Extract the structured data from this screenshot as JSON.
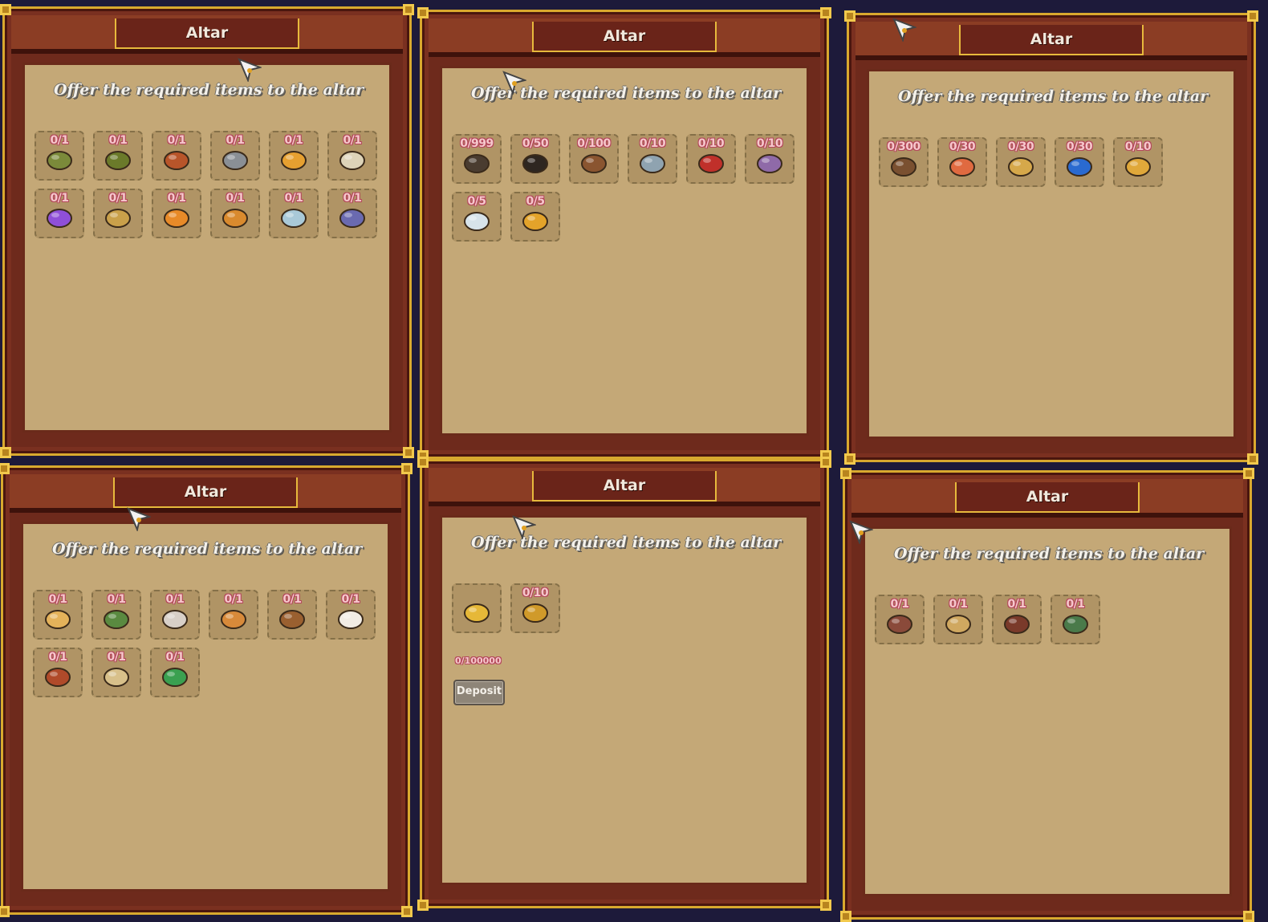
{
  "colors": {
    "background": "#1d1a3a",
    "panel_frame": "#6e2a1c",
    "gold_trim": "#d9a92e",
    "parchment": "#c4a877",
    "slot": "#b09465",
    "count_text": "#f6c8cc"
  },
  "panels": [
    {
      "title": "Altar",
      "prompt": "Offer the required items to the altar",
      "items": [
        {
          "count": "0/1",
          "icon": "green-fish-icon",
          "color": "#7b8a3a"
        },
        {
          "count": "0/1",
          "icon": "eel-fish-icon",
          "color": "#6b7a2a"
        },
        {
          "count": "0/1",
          "icon": "crab-icon",
          "color": "#b8552a"
        },
        {
          "count": "0/1",
          "icon": "grey-fish-icon",
          "color": "#8a8f95"
        },
        {
          "count": "0/1",
          "icon": "goldfish-icon",
          "color": "#e6a030"
        },
        {
          "count": "0/1",
          "icon": "bone-fish-icon",
          "color": "#ddd3b8"
        },
        {
          "count": "0/1",
          "icon": "rainbow-fish-icon",
          "color": "#8f4fd8"
        },
        {
          "count": "0/1",
          "icon": "golden-dragon-fish-icon",
          "color": "#c9a04a"
        },
        {
          "count": "0/1",
          "icon": "fire-fish-icon",
          "color": "#e88a28"
        },
        {
          "count": "0/1",
          "icon": "seahorse-icon",
          "color": "#d98a2e"
        },
        {
          "count": "0/1",
          "icon": "crystal-fish-icon",
          "color": "#a9c9d8"
        },
        {
          "count": "0/1",
          "icon": "manta-ray-icon",
          "color": "#6a6ab0"
        }
      ]
    },
    {
      "title": "Altar",
      "prompt": "Offer the required items to the altar",
      "items": [
        {
          "count": "0/999",
          "icon": "stone-icon",
          "color": "#4a3c30"
        },
        {
          "count": "0/50",
          "icon": "coal-icon",
          "color": "#2e2620"
        },
        {
          "count": "0/100",
          "icon": "copper-ore-icon",
          "color": "#8a5530"
        },
        {
          "count": "0/10",
          "icon": "iron-ore-icon",
          "color": "#8fa3b0"
        },
        {
          "count": "0/10",
          "icon": "ruby-ore-icon",
          "color": "#c0302a"
        },
        {
          "count": "0/10",
          "icon": "amethyst-ore-icon",
          "color": "#8f6aa8"
        },
        {
          "count": "0/5",
          "icon": "diamond-icon",
          "color": "#d7e3ea"
        },
        {
          "count": "0/5",
          "icon": "gold-nugget-icon",
          "color": "#e3a32a"
        }
      ]
    },
    {
      "title": "Altar",
      "prompt": "Offer the required items to the altar",
      "items": [
        {
          "count": "0/300",
          "icon": "wood-log-icon",
          "color": "#7a5030"
        },
        {
          "count": "0/30",
          "icon": "red-crystal-icon",
          "color": "#e06a40"
        },
        {
          "count": "0/30",
          "icon": "gold-stone-icon",
          "color": "#d6a84a"
        },
        {
          "count": "0/30",
          "icon": "blue-crystal-icon",
          "color": "#2a6ad0"
        },
        {
          "count": "0/10",
          "icon": "sand-dollar-icon",
          "color": "#e0a83a"
        }
      ]
    },
    {
      "title": "Altar",
      "prompt": "Offer the required items to the altar",
      "items": [
        {
          "count": "0/1",
          "icon": "cake-slice-icon",
          "color": "#e4b25a"
        },
        {
          "count": "0/1",
          "icon": "ramen-bowl-icon",
          "color": "#5a8a40"
        },
        {
          "count": "0/1",
          "icon": "dumplings-icon",
          "color": "#d8d0c8"
        },
        {
          "count": "0/1",
          "icon": "pizza-slice-icon",
          "color": "#d88a3a"
        },
        {
          "count": "0/1",
          "icon": "cookies-icon",
          "color": "#9a6030"
        },
        {
          "count": "0/1",
          "icon": "coffee-cup-icon",
          "color": "#f2ece4"
        },
        {
          "count": "0/1",
          "icon": "soup-bowl-icon",
          "color": "#b04a2a"
        },
        {
          "count": "0/1",
          "icon": "parfait-icon",
          "color": "#d8c08a"
        },
        {
          "count": "0/1",
          "icon": "green-drink-icon",
          "color": "#3aa050"
        }
      ]
    },
    {
      "title": "Altar",
      "prompt": "Offer the required items to the altar",
      "items": [
        {
          "count": "",
          "icon": "gold-coins-icon",
          "color": "#e6b838"
        },
        {
          "count": "0/10",
          "icon": "gold-bar-icon",
          "color": "#d09a2a"
        }
      ],
      "funds": "0/100000",
      "deposit_label": "Deposit"
    },
    {
      "title": "Altar",
      "prompt": "Offer the required items to the altar",
      "items": [
        {
          "count": "0/1",
          "icon": "dagger-icon",
          "color": "#8a4a3a"
        },
        {
          "count": "0/1",
          "icon": "fossil-plate-icon",
          "color": "#d0a860"
        },
        {
          "count": "0/1",
          "icon": "chocolate-heart-icon",
          "color": "#7a3a2a"
        },
        {
          "count": "0/1",
          "icon": "sapling-icon",
          "color": "#4a7a4a"
        }
      ]
    }
  ]
}
